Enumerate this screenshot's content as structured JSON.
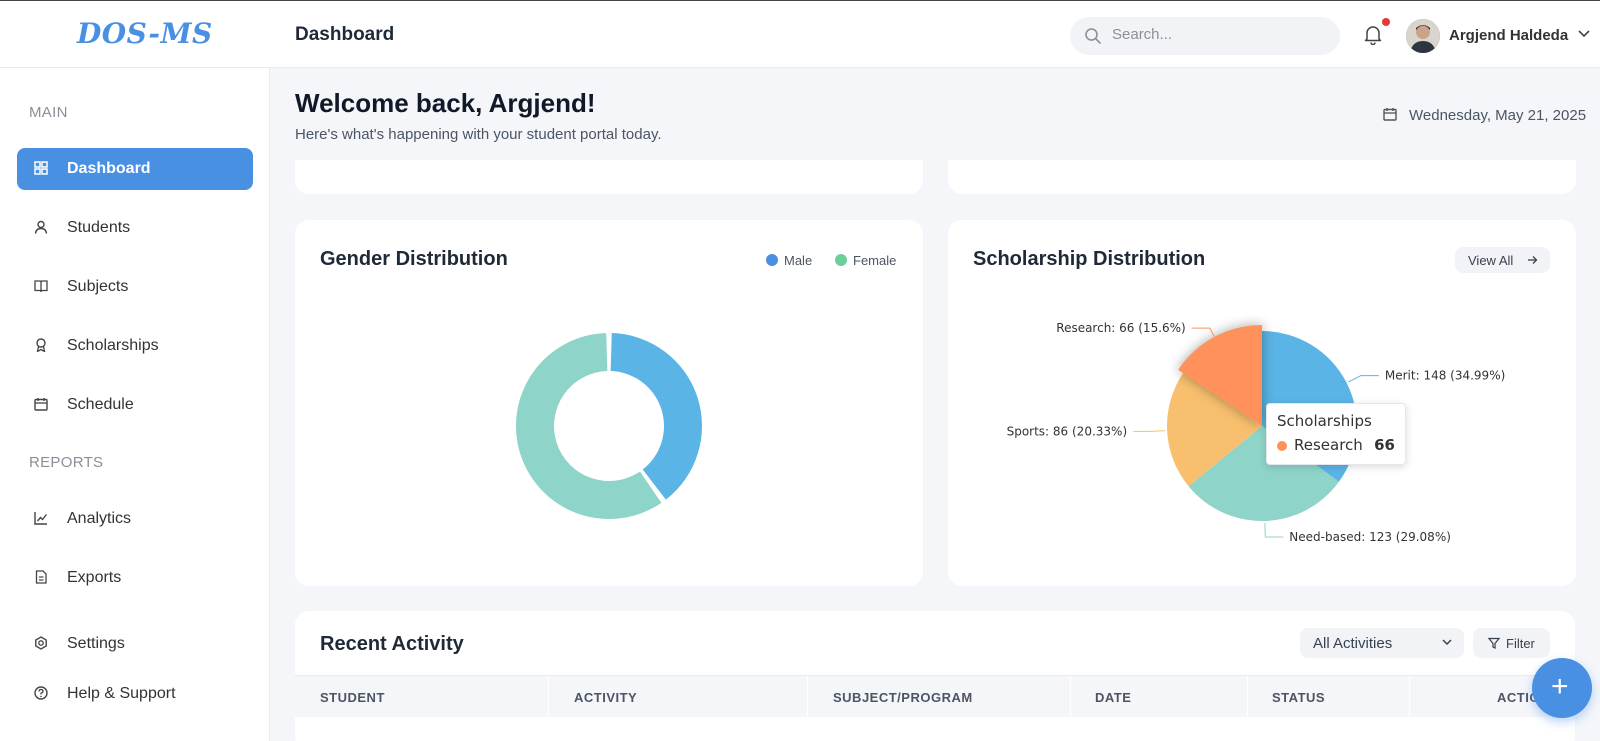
{
  "app": {
    "logo": "DOS-MS",
    "page_title": "Dashboard"
  },
  "search": {
    "placeholder": "Search..."
  },
  "user": {
    "name": "Argjend Haldeda"
  },
  "sidebar": {
    "sections": {
      "main": "MAIN",
      "reports": "REPORTS"
    },
    "items": [
      {
        "label": "Dashboard",
        "icon": "grid-icon",
        "active": true
      },
      {
        "label": "Students",
        "icon": "user-icon"
      },
      {
        "label": "Subjects",
        "icon": "book-icon"
      },
      {
        "label": "Scholarships",
        "icon": "award-icon"
      },
      {
        "label": "Schedule",
        "icon": "calendar-icon"
      },
      {
        "label": "Analytics",
        "icon": "chart-line-icon"
      },
      {
        "label": "Exports",
        "icon": "file-icon"
      },
      {
        "label": "Settings",
        "icon": "gear-icon"
      },
      {
        "label": "Help & Support",
        "icon": "help-icon"
      }
    ]
  },
  "welcome": {
    "title": "Welcome back, Argjend!",
    "subtitle": "Here's what's happening with your student portal today.",
    "date": "Wednesday, May 21, 2025"
  },
  "gender_card": {
    "title": "Gender Distribution",
    "legend": [
      {
        "label": "Male",
        "color": "#4a90e2"
      },
      {
        "label": "Female",
        "color": "#6ccf9b"
      }
    ]
  },
  "scholarship_card": {
    "title": "Scholarship Distribution",
    "view_all": "View All",
    "tooltip": {
      "title": "Scholarships",
      "name": "Research",
      "value": "66"
    }
  },
  "chart_data": [
    {
      "type": "pie",
      "title": "Gender Distribution",
      "donut": true,
      "series": [
        {
          "name": "Male",
          "value": 40,
          "color": "#5ab4e6"
        },
        {
          "name": "Female",
          "value": 60,
          "color": "#8ed4c8"
        }
      ]
    },
    {
      "type": "pie",
      "title": "Scholarship Distribution",
      "series": [
        {
          "name": "Merit",
          "value": 148,
          "label": "Merit: 148 (34.99%)",
          "color": "#5ab4e6"
        },
        {
          "name": "Need-based",
          "value": 123,
          "label": "Need-based: 123 (29.08%)",
          "color": "#8ed4c8"
        },
        {
          "name": "Sports",
          "value": 86,
          "label": "Sports: 86 (20.33%)",
          "color": "#f8c06e"
        },
        {
          "name": "Research",
          "value": 66,
          "label": "Research: 66 (15.6%)",
          "color": "#ff915a",
          "highlighted": true
        }
      ]
    }
  ],
  "activity": {
    "title": "Recent Activity",
    "filter_select": "All Activities",
    "filter_button": "Filter",
    "columns": [
      "STUDENT",
      "ACTIVITY",
      "SUBJECT/PROGRAM",
      "DATE",
      "STATUS",
      "ACTIONS"
    ]
  },
  "fab": {
    "label": "+"
  }
}
